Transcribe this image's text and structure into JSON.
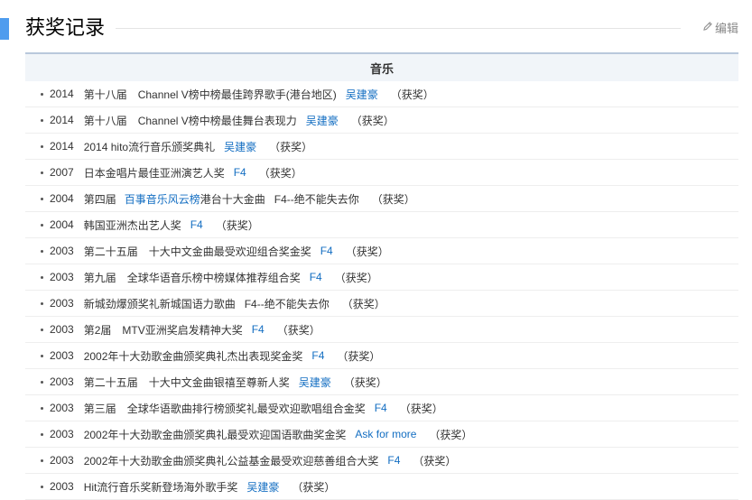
{
  "section": {
    "title": "获奖记录",
    "edit_label": "编辑",
    "accent_color": "#4f9cee",
    "link_color": "#136ec2"
  },
  "table": {
    "header": "音乐",
    "rows": [
      {
        "year": "2014",
        "award": "第十八届　Channel V榜中榜最佳跨界歌手(港台地区)",
        "person": "吴建豪",
        "result": "（获奖）"
      },
      {
        "year": "2014",
        "award": "第十八届　Channel V榜中榜最佳舞台表现力",
        "person": "吴建豪",
        "result": "（获奖）"
      },
      {
        "year": "2014",
        "award": "2014 hito流行音乐颁奖典礼",
        "person": "吴建豪",
        "result": "（获奖）"
      },
      {
        "year": "2007",
        "award": "日本金唱片最佳亚洲演艺人奖",
        "person": "F4",
        "result": "（获奖）"
      },
      {
        "year": "2004",
        "award_prefix": "第四届",
        "award_link": "百事音乐风云榜",
        "award": "港台十大金曲",
        "work": "F4--绝不能失去你",
        "result": "（获奖）"
      },
      {
        "year": "2004",
        "award": "韩国亚洲杰出艺人奖",
        "person": "F4",
        "result": "（获奖）"
      },
      {
        "year": "2003",
        "award": "第二十五届　十大中文金曲最受欢迎组合奖金奖",
        "person": "F4",
        "result": "（获奖）"
      },
      {
        "year": "2003",
        "award": "第九届　全球华语音乐榜中榜媒体推荐组合奖",
        "person": "F4",
        "result": "（获奖）"
      },
      {
        "year": "2003",
        "award": "新城劲爆颁奖礼新城国语力歌曲",
        "work": "F4--绝不能失去你",
        "result": "（获奖）"
      },
      {
        "year": "2003",
        "award": "第2届　MTV亚洲奖启发精神大奖",
        "person": "F4",
        "result": "（获奖）"
      },
      {
        "year": "2003",
        "award": "2002年十大劲歌金曲颁奖典礼杰出表现奖金奖",
        "person": "F4",
        "result": "（获奖）"
      },
      {
        "year": "2003",
        "award": "第二十五届　十大中文金曲银禧至尊新人奖",
        "person": "吴建豪",
        "result": "（获奖）"
      },
      {
        "year": "2003",
        "award": "第三届　全球华语歌曲排行榜颁奖礼最受欢迎歌唱组合金奖",
        "person": "F4",
        "result": "（获奖）"
      },
      {
        "year": "2003",
        "award": "2002年十大劲歌金曲颁奖典礼最受欢迎国语歌曲奖金奖",
        "person": "Ask for more",
        "result": "（获奖）"
      },
      {
        "year": "2003",
        "award": "2002年十大劲歌金曲颁奖典礼公益基金最受欢迎慈善组合大奖",
        "person": "F4",
        "result": "（获奖）"
      },
      {
        "year": "2003",
        "award": "Hit流行音乐奖新登场海外歌手奖",
        "person": "吴建豪",
        "result": "（获奖）"
      }
    ]
  }
}
